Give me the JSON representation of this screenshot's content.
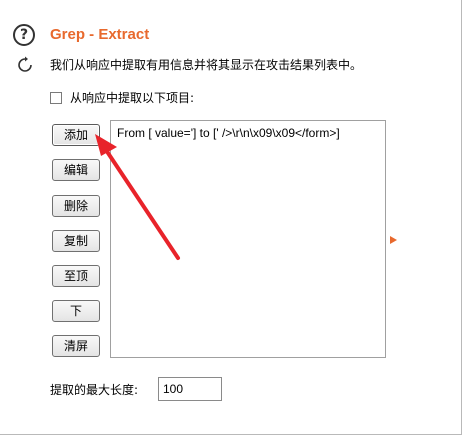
{
  "header": {
    "title": "Grep - Extract",
    "description": "我们从响应中提取有用信息并将其显示在攻击结果列表中。"
  },
  "extract": {
    "checkbox_label": "从响应中提取以下项目:",
    "checked": false
  },
  "buttons": {
    "add": "添加",
    "edit": "编辑",
    "delete": "删除",
    "copy": "复制",
    "top": "至顶",
    "down": "下",
    "clear": "清屏"
  },
  "list": {
    "items": [
      "From [ value='] to [' />\\r\\n\\x09\\x09</form>]"
    ]
  },
  "max_length": {
    "label": "提取的最大长度:",
    "value": "100"
  },
  "colors": {
    "title": "#e8692d",
    "annotation_arrow": "#e8232a"
  },
  "icons": [
    "help-icon",
    "refresh-icon",
    "expand-arrow-icon"
  ]
}
